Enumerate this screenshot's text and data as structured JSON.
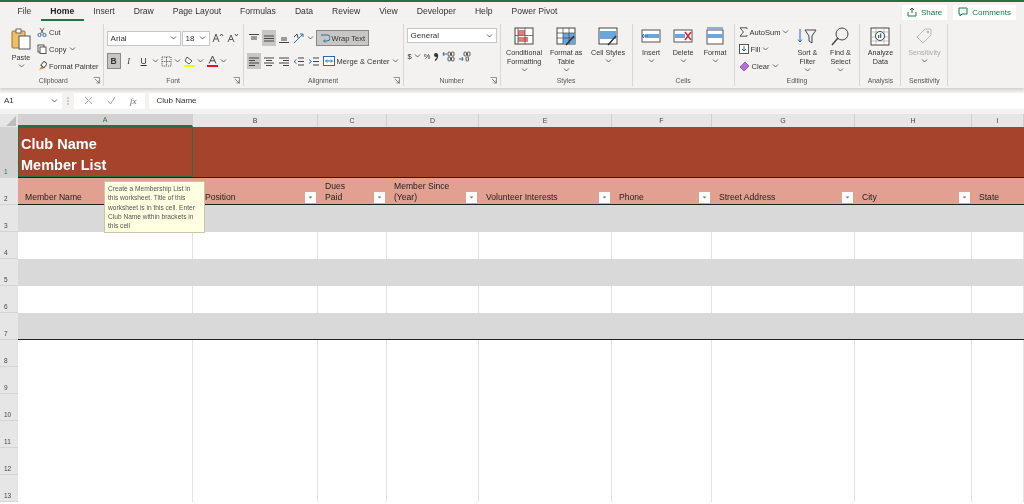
{
  "menu_tabs": [
    {
      "label": "File",
      "selected": false
    },
    {
      "label": "Home",
      "selected": true
    },
    {
      "label": "Insert",
      "selected": false
    },
    {
      "label": "Draw",
      "selected": false
    },
    {
      "label": "Page Layout",
      "selected": false
    },
    {
      "label": "Formulas",
      "selected": false
    },
    {
      "label": "Data",
      "selected": false
    },
    {
      "label": "Review",
      "selected": false
    },
    {
      "label": "View",
      "selected": false
    },
    {
      "label": "Developer",
      "selected": false
    },
    {
      "label": "Help",
      "selected": false
    },
    {
      "label": "Power Pivot",
      "selected": false
    }
  ],
  "share_button": "Share",
  "comments_button": "Comments",
  "ribbon": {
    "clipboard": {
      "paste": "Paste",
      "cut": "Cut",
      "copy": "Copy",
      "format_painter": "Format Painter",
      "label": "Clipboard"
    },
    "font": {
      "name": "Arial",
      "size": "18",
      "styles": [
        {
          "label": "B",
          "selected": true
        },
        {
          "label": "I",
          "selected": false
        },
        {
          "label": "U",
          "selected": false
        }
      ],
      "label": "Font"
    },
    "alignment": {
      "vertical": [
        {
          "kind": "top",
          "selected": false
        },
        {
          "kind": "middle",
          "selected": true
        },
        {
          "kind": "bottom",
          "selected": false
        }
      ],
      "horizontal": [
        {
          "kind": "left",
          "selected": true
        },
        {
          "kind": "center",
          "selected": false
        },
        {
          "kind": "right",
          "selected": false
        }
      ],
      "wrap_text": {
        "label": "Wrap Text",
        "selected": true
      },
      "merge": "Merge & Center",
      "label": "Alignment"
    },
    "number": {
      "format": "General",
      "currency": "$",
      "percent": "%",
      "label": "Number"
    },
    "styles": {
      "buttons": [
        {
          "kind": "conditional",
          "label": "Conditional Formatting"
        },
        {
          "kind": "table",
          "label": "Format as Table"
        },
        {
          "kind": "cell",
          "label": "Cell Styles"
        }
      ],
      "label": "Styles"
    },
    "cells": {
      "buttons": [
        {
          "kind": "insert",
          "label": "Insert"
        },
        {
          "kind": "delete",
          "label": "Delete"
        },
        {
          "kind": "format",
          "label": "Format"
        }
      ],
      "label": "Cells"
    },
    "editing": {
      "autosum": "AutoSum",
      "fill": "Fill",
      "clear": "Clear",
      "sort": "Sort & Filter",
      "find": "Find & Select",
      "label": "Editing"
    },
    "analysis": {
      "button": "Analyze Data",
      "label": "Analysis"
    },
    "sensitivity": {
      "button": "Sensitivity",
      "disabled": true,
      "label": "Sensitivity"
    }
  },
  "formula_bar": {
    "name_box": "A1",
    "function_label": "fx",
    "value": "Club Name"
  },
  "sheet": {
    "columns": [
      {
        "letter": "A",
        "selected": true
      },
      {
        "letter": "B",
        "selected": false
      },
      {
        "letter": "C",
        "selected": false
      },
      {
        "letter": "D",
        "selected": false
      },
      {
        "letter": "E",
        "selected": false
      },
      {
        "letter": "F",
        "selected": false
      },
      {
        "letter": "G",
        "selected": false
      },
      {
        "letter": "H",
        "selected": false
      },
      {
        "letter": "I",
        "selected": false
      }
    ],
    "rows": [
      {
        "label": "1",
        "selected": true
      },
      {
        "label": "2",
        "selected": false
      },
      {
        "label": "3",
        "selected": false
      },
      {
        "label": "4",
        "selected": false
      },
      {
        "label": "5",
        "selected": false
      },
      {
        "label": "6",
        "selected": false
      },
      {
        "label": "7",
        "selected": false
      },
      {
        "label": "8",
        "selected": false
      },
      {
        "label": "9",
        "selected": false
      },
      {
        "label": "10",
        "selected": false
      },
      {
        "label": "11",
        "selected": false
      },
      {
        "label": "12",
        "selected": false
      },
      {
        "label": "13",
        "selected": false
      }
    ],
    "title": "Club Name\nMember List",
    "headers": [
      {
        "text": "Member Name",
        "filter": false
      },
      {
        "text": "Position",
        "filter": true
      },
      {
        "text": "Dues\nPaid",
        "filter": true
      },
      {
        "text": "Member Since\n(Year)",
        "filter": true
      },
      {
        "text": "Volunteer Interests",
        "filter": true
      },
      {
        "text": "Phone",
        "filter": true
      },
      {
        "text": "Street Address",
        "filter": true
      },
      {
        "text": "City",
        "filter": true
      },
      {
        "text": "State",
        "filter": false
      }
    ],
    "tooltip": "Create a Membership List in this worksheet. Title of this worksheet is in this cell. Enter Club Name within brackets in this cell"
  }
}
